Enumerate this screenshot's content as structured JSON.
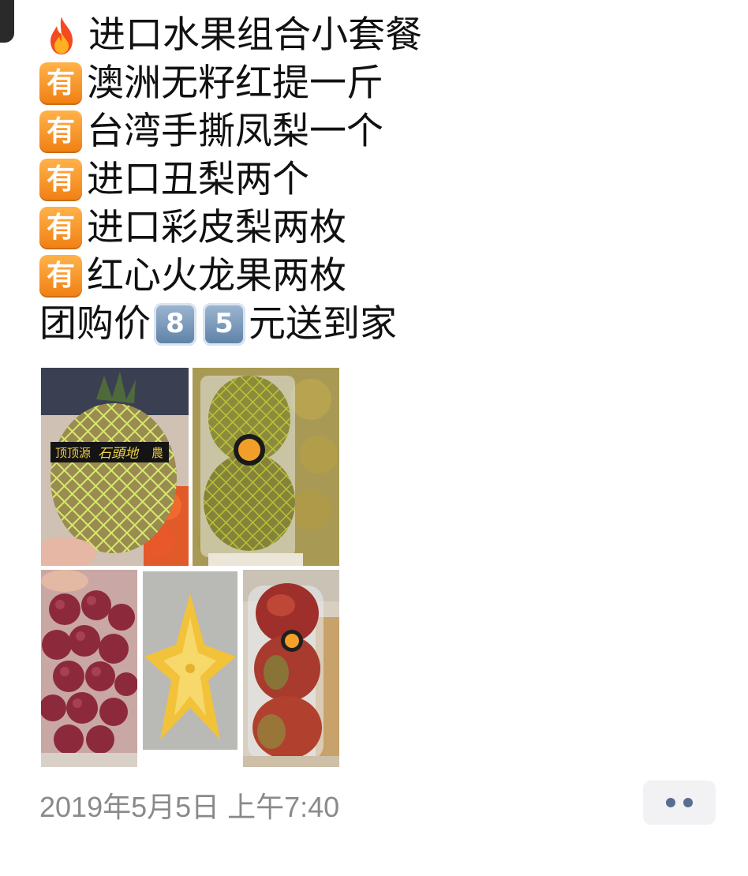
{
  "post": {
    "title": "进口水果组合小套餐",
    "badge_label": "有",
    "items": [
      "澳洲无籽红提一斤",
      "台湾手撕凤梨一个",
      "进口丑梨两个",
      "进口彩皮梨两枚",
      "红心火龙果两枚"
    ],
    "price_prefix": "团购价",
    "price_digits": [
      "8",
      "5"
    ],
    "price_suffix": "元送到家",
    "net_label_left": "顶顶源",
    "net_label_brand": "石頭地",
    "net_label_right": "農"
  },
  "photos": [
    {
      "subject": "pineapple-in-net"
    },
    {
      "subject": "ugly-pears-in-net"
    },
    {
      "subject": "red-grapes"
    },
    {
      "subject": "star-fruit"
    },
    {
      "subject": "colored-pears-pack"
    }
  ],
  "footer": {
    "timestamp": "2019年5月5日 上午7:40"
  },
  "icons": {
    "title": "fire-icon",
    "badge": "you-badge-icon",
    "price": "keycap-digit-icon",
    "more": "more-dots-icon"
  }
}
